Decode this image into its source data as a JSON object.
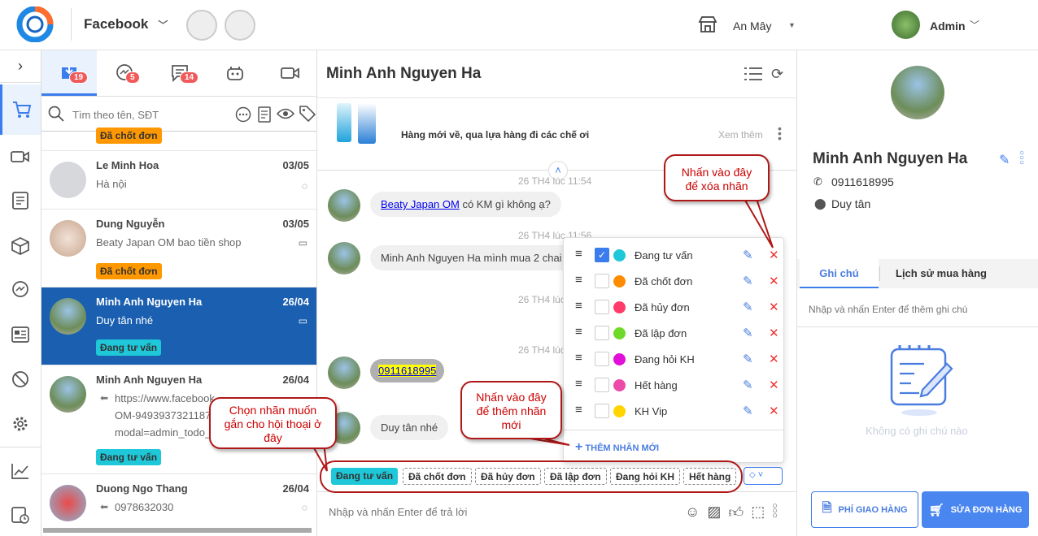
{
  "header": {
    "page": "Facebook",
    "store": "An Mây",
    "user": "Admin"
  },
  "list": {
    "tabs": [
      {
        "name": "inbox",
        "badge": "19"
      },
      {
        "name": "messenger",
        "badge": "5"
      },
      {
        "name": "comments",
        "badge": "14"
      },
      {
        "name": "bot",
        "badge": ""
      },
      {
        "name": "video",
        "badge": ""
      }
    ],
    "search_placeholder": "Tìm theo tên, SĐT",
    "partial_tag": "Đã chốt đơn",
    "items": [
      {
        "name": "Le Minh Hoa",
        "date": "03/05",
        "preview": "Hà nội",
        "tag": ""
      },
      {
        "name": "Dung Nguyễn",
        "date": "03/05",
        "preview": "Beaty Japan OM bao tiền shop",
        "tag": "Đã chốt đơn"
      },
      {
        "name": "Minh Anh Nguyen Ha",
        "date": "26/04",
        "preview": "Duy tân nhé",
        "tag": "Đang tư vấn"
      },
      {
        "name": "Minh Anh Nguyen Ha",
        "date": "26/04",
        "preview_lines": [
          "https://www.facebook...",
          "OM-9493937321187...",
          "modal=admin_todo_..."
        ],
        "tag": "Đang tư vấn"
      },
      {
        "name": "Duong Ngo Thang",
        "date": "26/04",
        "preview": "0978632030",
        "tag": ""
      }
    ]
  },
  "chat": {
    "title": "Minh Anh Nguyen Ha",
    "post_text": "Hàng mới về, qua lựa hàng đi các chế ơi",
    "see_more": "Xem thêm",
    "messages": [
      {
        "time": "26 TH4 lúc 11:54",
        "link": "Beaty Japan OM",
        "text": "có KM gì không ạ?"
      },
      {
        "time": "26 TH4 lúc 11:56",
        "text": "Minh Anh Nguyen Ha mình mua 2 chai"
      },
      {
        "time": "26 TH4 lúc",
        "text": ""
      },
      {
        "time": "26 TH4 lúc",
        "phone": "0911618995"
      },
      {
        "time": "",
        "text": "Duy tân nhé"
      }
    ],
    "label_bar": [
      "Đang tư vấn",
      "Đã chốt đơn",
      "Đã hủy đơn",
      "Đã lập đơn",
      "Đang hỏi KH",
      "Hết hàng"
    ],
    "input_placeholder": "Nhập và nhấn Enter để trả lời"
  },
  "label_popup": {
    "labels": [
      {
        "name": "Đang tư vấn",
        "color": "#1ec8d8",
        "checked": true
      },
      {
        "name": "Đã chốt đơn",
        "color": "#ff8c00",
        "checked": false
      },
      {
        "name": "Đã hủy đơn",
        "color": "#ff3b6b",
        "checked": false
      },
      {
        "name": "Đã lập đơn",
        "color": "#6fd92a",
        "checked": false
      },
      {
        "name": "Đang hỏi KH",
        "color": "#e010d8",
        "checked": false
      },
      {
        "name": "Hết hàng",
        "color": "#ec4ca8",
        "checked": false
      },
      {
        "name": "KH Vip",
        "color": "#ffd400",
        "checked": false
      }
    ],
    "add_label": "THÊM NHÃN MỚI"
  },
  "callouts": {
    "delete": "Nhấn vào đây để xóa nhãn",
    "add": "Nhấn vào đây để thêm nhãn mới",
    "choose": "Chọn nhãn muốn gắn cho hội thoại ở đây"
  },
  "customer": {
    "name": "Minh Anh Nguyen Ha",
    "phone": "0911618995",
    "address": "Duy tân",
    "tabs": [
      "Ghi chú",
      "Lịch sử mua hàng"
    ],
    "note_placeholder": "Nhập và nhấn Enter để thêm ghi chú",
    "empty": "Không có ghi chú nào",
    "btn_shipping": "PHÍ GIAO HÀNG",
    "btn_order": "SỬA ĐƠN HÀNG"
  }
}
